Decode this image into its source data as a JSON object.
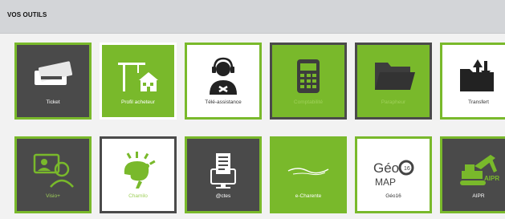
{
  "section": {
    "title": "VOS OUTILS"
  },
  "tiles": [
    {
      "label": "Ticket",
      "icon": "ticket-icon"
    },
    {
      "label": "Profil acheteur",
      "icon": "construction-building-icon"
    },
    {
      "label": "Télé-assistance",
      "icon": "support-headset-icon"
    },
    {
      "label": "Comptabilité",
      "icon": "calculator-icon"
    },
    {
      "label": "Parapheur",
      "icon": "folder-icon"
    },
    {
      "label": "Transfert",
      "icon": "transfer-folder-icon"
    },
    {
      "label": "Visio+",
      "icon": "video-call-icon"
    },
    {
      "label": "Chamilo",
      "icon": "chameleon-icon"
    },
    {
      "label": "@ctes",
      "icon": "document-monitor-icon"
    },
    {
      "label": "e-Charente",
      "icon": "e-charente-logo-icon"
    },
    {
      "label": "Géo16",
      "icon": "geo16-logo-icon",
      "logo_text": "GéoC16MAP"
    },
    {
      "label": "AIPR",
      "icon": "excavator-icon",
      "logo_text": "AIPR"
    }
  ],
  "colors": {
    "green": "#79b92b",
    "dark": "#4a4a4a",
    "white": "#ffffff",
    "header": "#d3d5d8"
  }
}
